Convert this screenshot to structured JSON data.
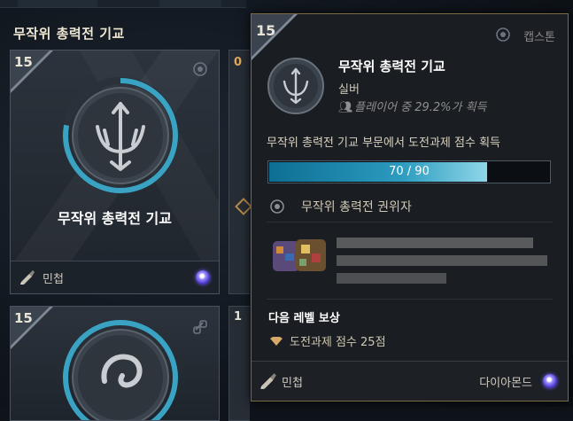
{
  "section": {
    "title": "무작위 총력전 기교"
  },
  "card": {
    "level": "15",
    "title": "무작위 총력전 기교",
    "category_label": "민첩",
    "progress_fraction": 0.78,
    "category_icon": "pen-scroll-icon",
    "tier_icon": "diamond-orb-icon"
  },
  "neighbor_card": {
    "level": "0"
  },
  "bottom_cards": [
    {
      "level": "15",
      "icon": "link-icon"
    },
    {
      "level": "1"
    }
  ],
  "tooltip": {
    "level": "15",
    "captain_label": "캡스톤",
    "name": "무작위 총력전 기교",
    "tier": "실버",
    "percent_text": "플레이어 중 29.2%가 획득",
    "description": "무작위 총력전 기교 부문에서 도전과제 점수 획득",
    "progress": {
      "current": 70,
      "max": 90,
      "text": "70 / 90"
    },
    "title_reward": "무작위 총력전 권위자",
    "next_level_title": "다음 레벨 보상",
    "next_level_reward": "도전과제 점수 25점",
    "footer_category": "민첩",
    "footer_tier": "다이아몬드"
  },
  "colors": {
    "accent_gold": "#7a6a45",
    "progress_fill": "#2b9bbf",
    "ring_teal": "#3aa3c4",
    "orb_purple": "#6a5cff"
  }
}
